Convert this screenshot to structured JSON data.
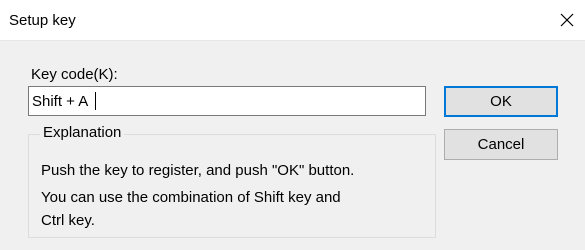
{
  "window": {
    "title": "Setup key",
    "close_icon": "close-icon"
  },
  "form": {
    "key_code_label": "Key code(K):",
    "key_code_value": "Shift + A"
  },
  "buttons": {
    "ok": "OK",
    "cancel": "Cancel"
  },
  "explanation": {
    "title": "Explanation",
    "line1": "Push the key to register, and push \"OK\" button.",
    "line2": "You can use the combination of Shift key and",
    "line3": "Ctrl key."
  }
}
